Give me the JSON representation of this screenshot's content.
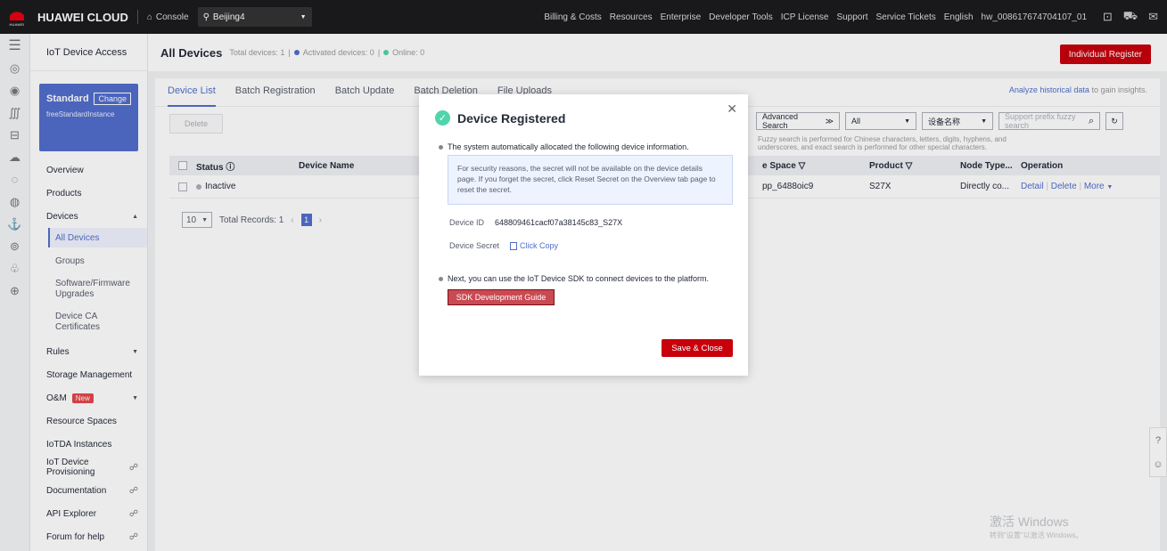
{
  "topbar": {
    "brand": "HUAWEI CLOUD",
    "logo_text": "HUAWEI",
    "console_label": "Console",
    "region": "Beijing4",
    "nav": [
      "Billing & Costs",
      "Resources",
      "Enterprise",
      "Developer Tools",
      "ICP License",
      "Support",
      "Service Tickets",
      "English",
      "hw_008617674704107_01"
    ]
  },
  "sidemenu": {
    "title": "IoT Device Access",
    "instance_label": "Standard",
    "change_label": "Change",
    "instance_name": "freeStandardInstance",
    "overview": "Overview",
    "products": "Products",
    "devices": "Devices",
    "all_devices": "All Devices",
    "groups": "Groups",
    "software_firmware_1": "Software/Firmware",
    "software_firmware_2": "Upgrades",
    "device_ca_1": "Device CA",
    "device_ca_2": "Certificates",
    "rules": "Rules",
    "storage": "Storage Management",
    "om": "O&M",
    "new_badge": "New",
    "resource_spaces": "Resource Spaces",
    "iotda_instances": "IoTDA Instances",
    "provisioning": "IoT Device Provisioning",
    "documentation": "Documentation",
    "api_explorer": "API Explorer",
    "forum": "Forum for help"
  },
  "page": {
    "title": "All Devices",
    "total": "Total devices: 1",
    "activated": "Activated devices: 0",
    "online": "Online: 0",
    "register_button": "Individual Register"
  },
  "tabs": [
    "Device List",
    "Batch Registration",
    "Batch Update",
    "Batch Deletion",
    "File Uploads"
  ],
  "analyze": {
    "link": "Analyze historical data",
    "rest": " to gain insights."
  },
  "toolbar": {
    "delete": "Delete",
    "advanced_search": "Advanced Search",
    "all": "All",
    "field": "设备名称",
    "search_placeholder": "Support prefix fuzzy search",
    "hint": "Fuzzy search is performed for Chinese characters, letters, digits, hyphens, and underscores, and exact search is performed for other special characters."
  },
  "table": {
    "headers": {
      "status": "Status",
      "device_name": "Device Name",
      "space": "e Space",
      "product": "Product",
      "node_type": "Node Type...",
      "operation": "Operation"
    },
    "row": {
      "status": "Inactive",
      "space": "pp_6488oic9",
      "product": "S27X",
      "node_type": "Directly co...",
      "detail": "Detail",
      "delete": "Delete",
      "more": "More"
    }
  },
  "pager": {
    "size": "10",
    "total": "Total Records: 1",
    "current": "1"
  },
  "modal": {
    "title": "Device Registered",
    "line1": "The system automatically allocated the following device information.",
    "notice": "For security reasons, the secret will not be available on the device details page. If you forget the secret, click Reset Secret on the Overview tab page to reset the secret.",
    "device_id_label": "Device ID",
    "device_id": "648809461cacf07a38145c83_S27X",
    "secret_label": "Device Secret",
    "click_copy": "Click Copy",
    "line2": "Next, you can use the IoT Device SDK to connect devices to the platform.",
    "sdk_button": "SDK Development Guide",
    "save_button": "Save & Close"
  },
  "watermark": {
    "line1": "激活 Windows",
    "line2": "转到\"设置\"以激活 Windows。"
  },
  "colors": {
    "brand_red": "#c7000b",
    "accent_blue": "#526ecc",
    "success_green": "#50d4ab"
  }
}
